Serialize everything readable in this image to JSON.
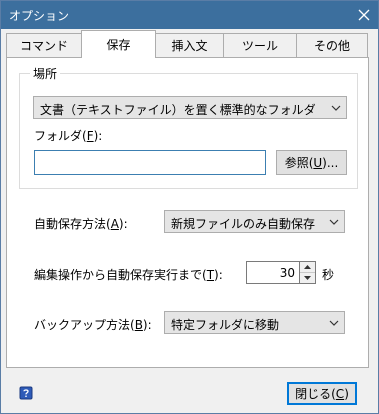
{
  "window": {
    "title": "オプション",
    "close_icon": "close-icon"
  },
  "tabs": [
    {
      "label": "コマンド",
      "active": false
    },
    {
      "label": "保存",
      "active": true
    },
    {
      "label": "挿入文",
      "active": false
    },
    {
      "label": "ツール",
      "active": false
    },
    {
      "label": "その他",
      "active": false
    }
  ],
  "location_group": {
    "legend": "場所",
    "location_select": "文書（テキストファイル）を置く標準的なフォルダ",
    "folder_label_pre": "フォルダ(",
    "folder_label_key": "F",
    "folder_label_post": "):",
    "folder_value": "",
    "browse_pre": "参照(",
    "browse_key": "U",
    "browse_post": ")..."
  },
  "autosave_method": {
    "label_pre": "自動保存方法(",
    "label_key": "A",
    "label_post": "):",
    "value": "新規ファイルのみ自動保存"
  },
  "autosave_delay": {
    "label_pre": "編集操作から自動保存実行まで(",
    "label_key": "T",
    "label_post": "):",
    "value": "30",
    "unit": "秒"
  },
  "backup_method": {
    "label_pre": "バックアップ方法(",
    "label_key": "B",
    "label_post": "):",
    "value": "特定フォルダに移動"
  },
  "footer": {
    "help_icon": "help-icon",
    "close_pre": "閉じる(",
    "close_key": "C",
    "close_post": ")"
  }
}
